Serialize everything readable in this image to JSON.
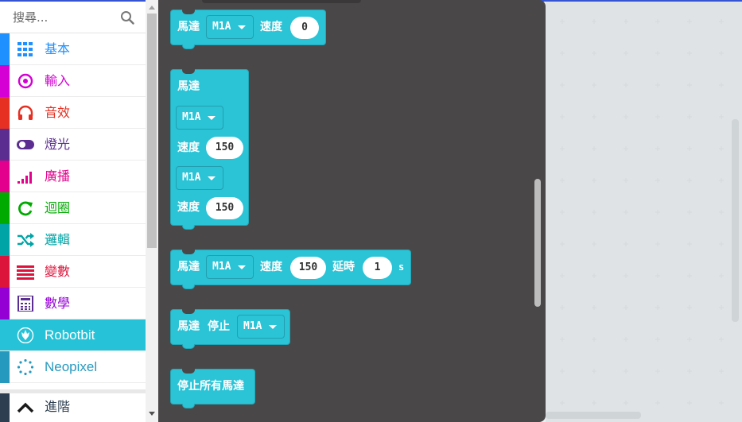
{
  "search": {
    "placeholder": "搜尋..."
  },
  "categories": [
    {
      "label": "基本",
      "color": "#1e90ff",
      "icon": "grid-icon"
    },
    {
      "label": "輸入",
      "color": "#d400d4",
      "icon": "target-icon"
    },
    {
      "label": "音效",
      "color": "#e63022",
      "icon": "headphones-icon"
    },
    {
      "label": "燈光",
      "color": "#5c2d91",
      "icon": "toggle-icon"
    },
    {
      "label": "廣播",
      "color": "#e3008c",
      "icon": "signal-icon"
    },
    {
      "label": "迴圈",
      "color": "#00aa00",
      "icon": "loop-icon"
    },
    {
      "label": "邏輯",
      "color": "#00a4a6",
      "icon": "shuffle-icon"
    },
    {
      "label": "變數",
      "color": "#dc143c",
      "icon": "list-icon"
    },
    {
      "label": "數學",
      "color": "#9400d3",
      "icon": "calculator-icon"
    },
    {
      "label": "Robotbit",
      "color": "#26c3d8",
      "icon": "rebel-icon"
    },
    {
      "label": "Neopixel",
      "color": "#2699bf",
      "icon": "ring-icon"
    }
  ],
  "advanced": {
    "label": "進階",
    "icon": "chevron-up-icon"
  },
  "blocks": {
    "motor_run": {
      "label": "馬達",
      "motor": "M1A",
      "speed_label": "速度",
      "speed": "0"
    },
    "dual_motor": {
      "label": "馬達",
      "motor1": "M1A",
      "speed1_label": "速度",
      "speed1": "150",
      "motor2": "M1A",
      "speed2_label": "速度",
      "speed2": "150"
    },
    "motor_delay": {
      "label": "馬達",
      "motor": "M1A",
      "speed_label": "速度",
      "speed": "150",
      "delay_label": "延時",
      "delay": "1",
      "unit": "s"
    },
    "motor_stop": {
      "label": "馬達",
      "stop_label": "停止",
      "motor": "M1A"
    },
    "stop_all": {
      "label": "停止所有馬達"
    }
  },
  "colors": {
    "block": "#2bc3d6",
    "flyout": "#4a4748",
    "workspace": "#ecf0f1",
    "active_category": "#26c3d8"
  }
}
